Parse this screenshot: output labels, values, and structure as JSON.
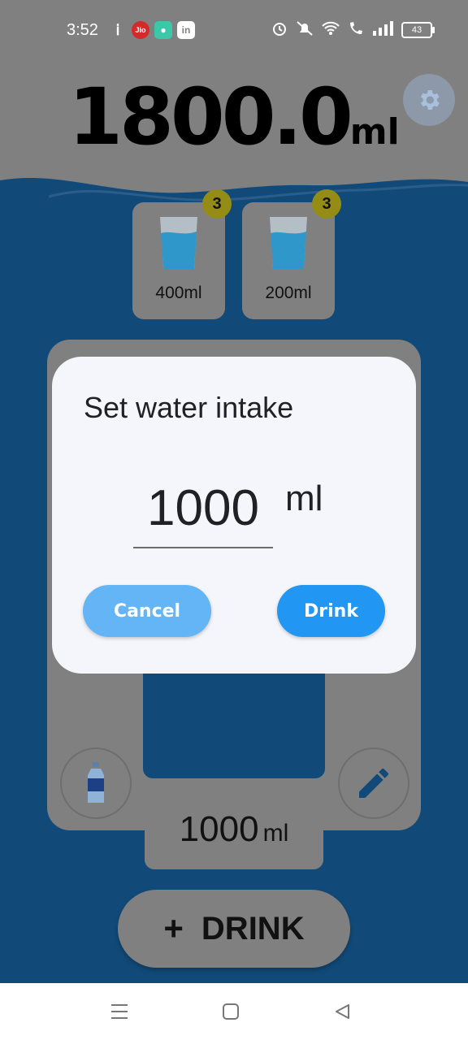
{
  "status_bar": {
    "time": "3:52",
    "battery": "43",
    "icons": [
      "info-icon",
      "jio-icon",
      "chat-app-icon",
      "linkedin-icon",
      "alarm-icon",
      "mute-icon",
      "wifi-icon",
      "wifi-call-icon",
      "signal-icon",
      "battery-icon"
    ]
  },
  "header": {
    "total_value": "1800.0",
    "total_unit": "ml",
    "settings_icon": "gear-icon"
  },
  "presets": [
    {
      "label": "400ml",
      "count": "3",
      "icon": "glass-icon"
    },
    {
      "label": "200ml",
      "count": "3",
      "icon": "glass-icon"
    }
  ],
  "container": {
    "amount_value": "1000",
    "amount_unit": "ml",
    "left_icon": "bottle-icon",
    "right_icon": "pencil-icon"
  },
  "drink_button": {
    "plus": "+",
    "label": "DRINK"
  },
  "dialog": {
    "title": "Set water intake",
    "value": "1000",
    "unit": "ml",
    "cancel_label": "Cancel",
    "drink_label": "Drink"
  },
  "colors": {
    "water": "#114a78",
    "overlay_grey": "#808080",
    "badge": "#958c16",
    "dialog_bg": "#f4f6fb",
    "cancel_btn": "#64b5f6",
    "drink_btn": "#2196f3"
  },
  "nav_bar": {
    "icons": [
      "menu-icon",
      "home-icon",
      "back-icon"
    ]
  }
}
